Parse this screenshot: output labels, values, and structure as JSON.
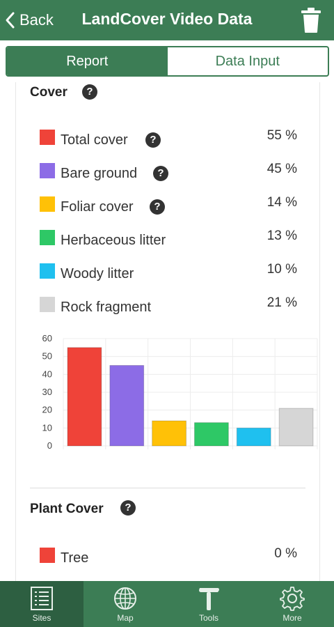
{
  "header": {
    "back_label": "Back",
    "title": "LandCover Video Data",
    "trash_icon": "trash-icon"
  },
  "tabs": {
    "report": "Report",
    "data_input": "Data Input",
    "active": "report"
  },
  "cover": {
    "title": "Cover",
    "help": "?",
    "items": [
      {
        "label": "Total cover",
        "value": "55 %",
        "color": "#ef4339",
        "has_help": true
      },
      {
        "label": "Bare ground",
        "value": "45 %",
        "color": "#8c6ce6",
        "has_help": true
      },
      {
        "label": "Foliar cover",
        "value": "14 %",
        "color": "#ffc107",
        "has_help": true
      },
      {
        "label": "Herbaceous litter",
        "value": "13 %",
        "color": "#2ec866",
        "has_help": false
      },
      {
        "label": "Woody litter",
        "value": "10 %",
        "color": "#1fc0ef",
        "has_help": false
      },
      {
        "label": "Rock fragment",
        "value": "21 %",
        "color": "#d6d6d6",
        "has_help": false
      }
    ]
  },
  "chart_data": {
    "type": "bar",
    "categories": [
      "Total cover",
      "Bare ground",
      "Foliar cover",
      "Herbaceous litter",
      "Woody litter",
      "Rock fragment"
    ],
    "values": [
      55,
      45,
      14,
      13,
      10,
      21
    ],
    "colors": [
      "#ef4339",
      "#8c6ce6",
      "#ffc107",
      "#2ec866",
      "#1fc0ef",
      "#d6d6d6"
    ],
    "ylim": [
      0,
      60
    ],
    "yticks": [
      "0",
      "10",
      "20",
      "30",
      "40",
      "50",
      "60"
    ],
    "grid": true,
    "title": "",
    "xlabel": "",
    "ylabel": ""
  },
  "plant_cover": {
    "title": "Plant Cover",
    "help": "?",
    "items": [
      {
        "label": "Tree",
        "value": "0 %",
        "color": "#ef4339"
      }
    ]
  },
  "nav": [
    {
      "label": "Sites",
      "icon": "list-icon",
      "active": true
    },
    {
      "label": "Map",
      "icon": "globe-icon",
      "active": false
    },
    {
      "label": "Tools",
      "icon": "hammer-icon",
      "active": false
    },
    {
      "label": "More",
      "icon": "gear-icon",
      "active": false
    }
  ]
}
